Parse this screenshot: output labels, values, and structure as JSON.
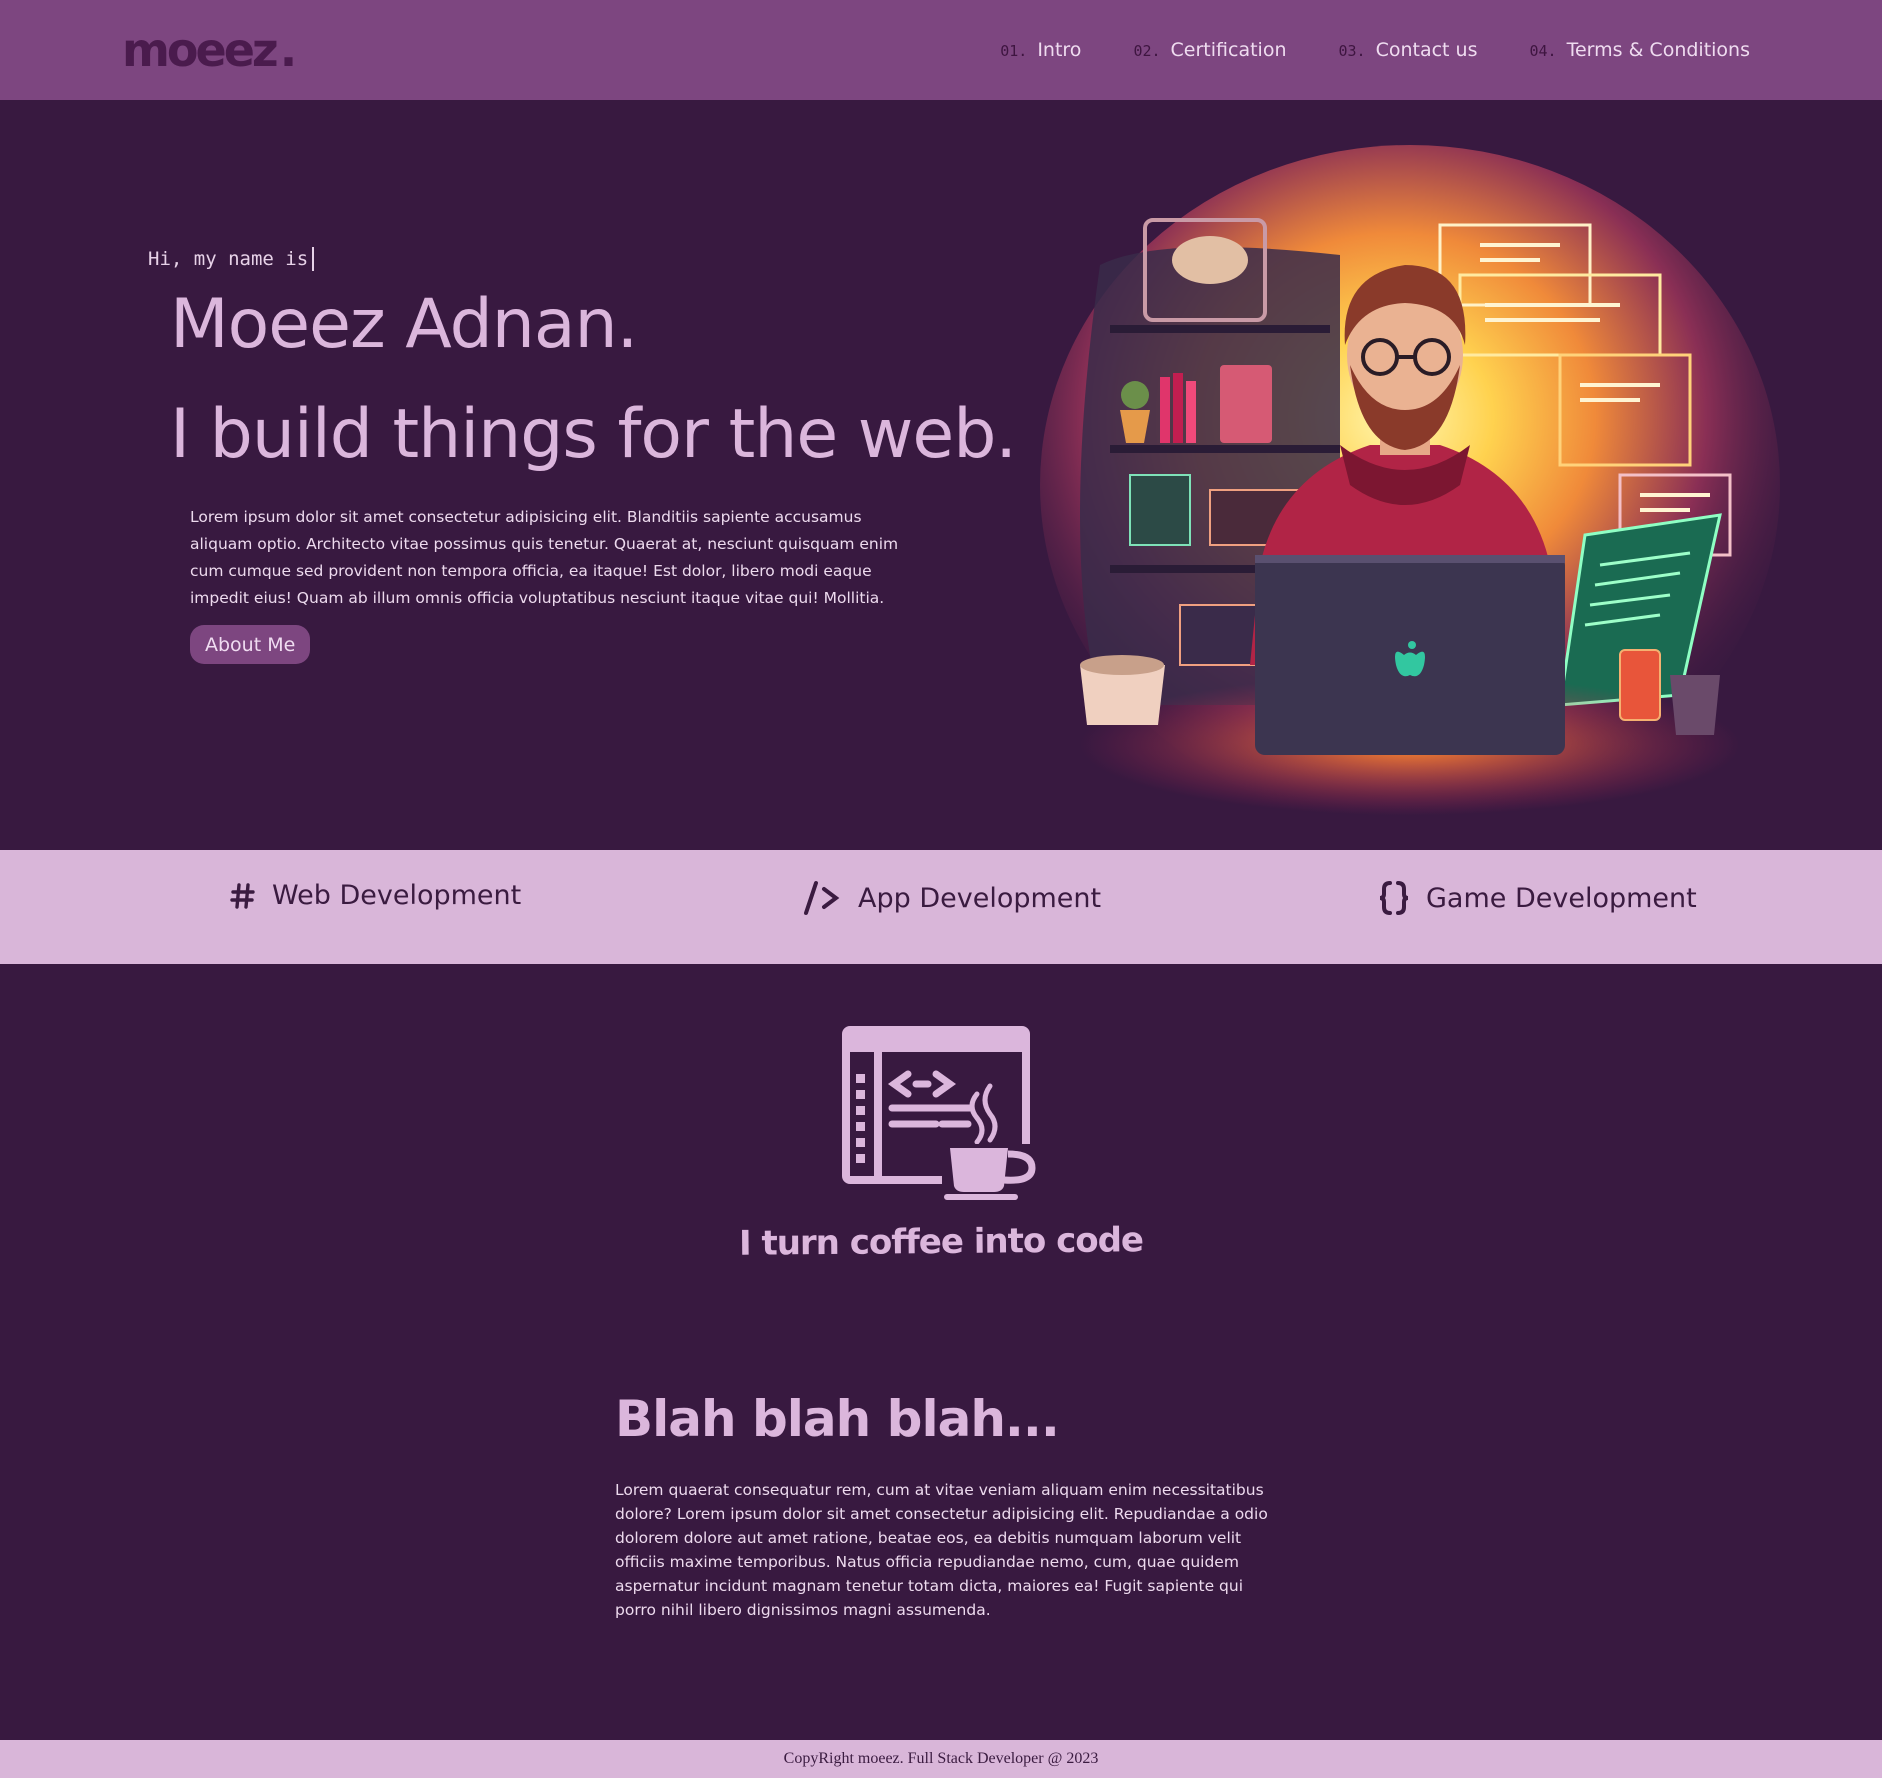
{
  "brand": {
    "logo_text": "moeez",
    "logo_dot": "."
  },
  "nav": {
    "links": [
      {
        "num": "01.",
        "label": "Intro"
      },
      {
        "num": "02.",
        "label": "Certification"
      },
      {
        "num": "03.",
        "label": "Contact us"
      },
      {
        "num": "04.",
        "label": "Terms & Conditions"
      }
    ]
  },
  "hero": {
    "typing_text": "Hi, my name is",
    "name": "Moeez Adnan.",
    "tagline": "I build things for the web.",
    "description": "Lorem ipsum dolor sit amet consectetur adipisicing elit. Blanditiis sapiente accusamus aliquam optio. Architecto vitae possimus quis tenetur. Quaerat at, nesciunt quisquam enim cum cumque sed provident non tempora officia, ea itaque! Est dolor, libero modi eaque impedit eius! Quam ab illum omnis officia voluptatibus nesciunt itaque vitae qui! Mollitia.",
    "about_button": "About Me"
  },
  "services": [
    {
      "icon": "hash-icon",
      "label": "Web Development"
    },
    {
      "icon": "code-slash-icon",
      "label": "App Development"
    },
    {
      "icon": "curly-braces-icon",
      "label": "Game Development"
    }
  ],
  "coffee": {
    "icon": "coffee-code-icon",
    "caption": "I turn coffee into code"
  },
  "blah": {
    "title": "Blah blah blah...",
    "text": "Lorem quaerat consequatur rem, cum at vitae veniam aliquam enim necessitatibus dolore? Lorem ipsum dolor sit amet consectetur adipisicing elit. Repudiandae a odio dolorem dolore aut amet ratione, beatae eos, ea debitis numquam laborum velit officiis maxime temporibus. Natus officia repudiandae nemo, cum, quae quidem aspernatur incidunt magnam tenetur totam dicta, maiores ea! Fugit sapiente qui porro nihil libero dignissimos magni assumenda."
  },
  "footer": {
    "text": "CopyRight moeez. Full Stack Developer @ 2023"
  },
  "colors": {
    "nav_bg": "#7d4680",
    "page_bg": "#381940",
    "strip_bg": "#d9b6d9",
    "accent_text": "#dbb6dc",
    "dark_text": "#3a1b40"
  }
}
